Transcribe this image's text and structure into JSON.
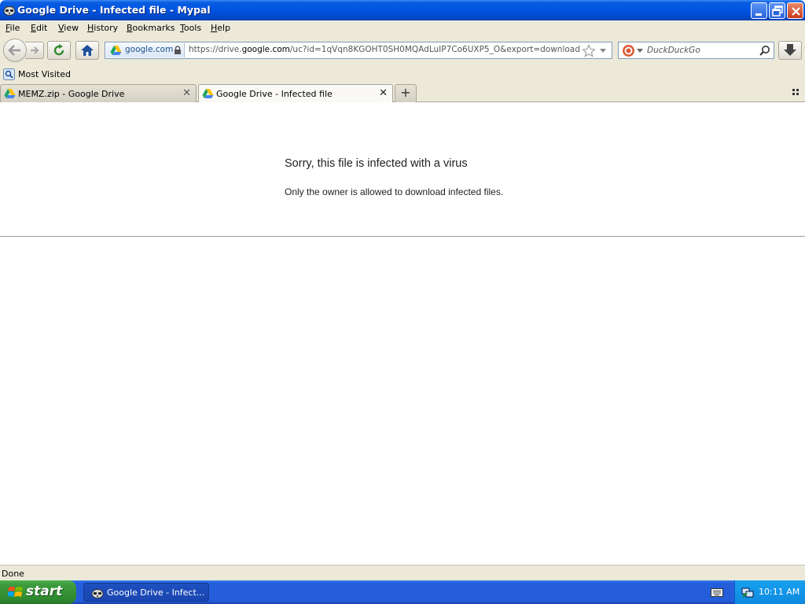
{
  "window": {
    "title": "Google Drive - Infected file - Mypal"
  },
  "menu": {
    "items": [
      {
        "accel": "F",
        "rest": "ile"
      },
      {
        "accel": "E",
        "rest": "dit"
      },
      {
        "accel": "V",
        "rest": "iew"
      },
      {
        "accel": "H",
        "rest": "istory"
      },
      {
        "accel": "B",
        "rest": "ookmarks"
      },
      {
        "accel": "T",
        "rest": "ools"
      },
      {
        "accel": "H",
        "rest": "elp"
      }
    ]
  },
  "urlbar": {
    "identity": "google.com",
    "url_prefix": "https://drive.",
    "url_domain": "google.com",
    "url_rest": "/uc?id=1qVqn8KGOHT0SH0MQAdLuIP7Co6UXP5_O&export=download"
  },
  "search": {
    "placeholder": "DuckDuckGo"
  },
  "bookmarks": {
    "most_visited": "Most Visited"
  },
  "tabs": [
    {
      "label": "MEMZ.zip - Google Drive",
      "active": false
    },
    {
      "label": "Google Drive - Infected file",
      "active": true
    }
  ],
  "page": {
    "error_title": "Sorry, this file is infected with a virus",
    "error_message": "Only the owner is allowed to download infected files."
  },
  "status": {
    "text": "Done"
  },
  "taskbar": {
    "start_label": "start",
    "task_label": "Google Drive - Infect...",
    "clock": "10:11 AM"
  },
  "colors": {
    "titlebar": "#0054e3",
    "taskbar": "#245edb",
    "start_green": "#3c9a3c",
    "chrome_bg": "#ece9d8"
  },
  "icons": {
    "app": "raccoon-icon",
    "drive": "google-drive-icon",
    "lock": "lock-icon",
    "star": "star-icon",
    "duckduckgo": "duckduckgo-icon",
    "search": "search-icon",
    "download": "download-arrow-icon"
  }
}
